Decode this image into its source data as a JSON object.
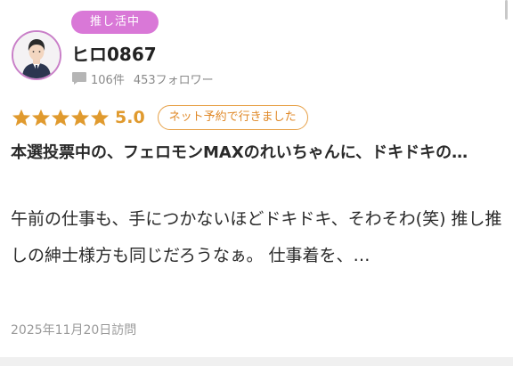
{
  "review": {
    "badge": "推し活中",
    "user": {
      "name": "ヒロ0867",
      "review_count": "106件",
      "followers": "453フォロワー",
      "avatar_icon": "user-avatar-icon"
    },
    "rating": {
      "stars": 5,
      "value": "5.0",
      "star_color": "#e09a2e",
      "reservation_tag": "ネット予約で行きました"
    },
    "title": "本選投票中の、フェロモンMAXのれいちゃんに、ドキドキの…",
    "body": "午前の仕事も、手につかないほどドキドキ、そわそわ(笑) 推し推しの紳士様方も同じだろうなぁ。 仕事着を、…",
    "visit_date": "2025年11月20日訪問"
  },
  "colors": {
    "badge": "#d978d7",
    "avatar_border": "#c97fc8",
    "accent": "#e09a2e"
  }
}
